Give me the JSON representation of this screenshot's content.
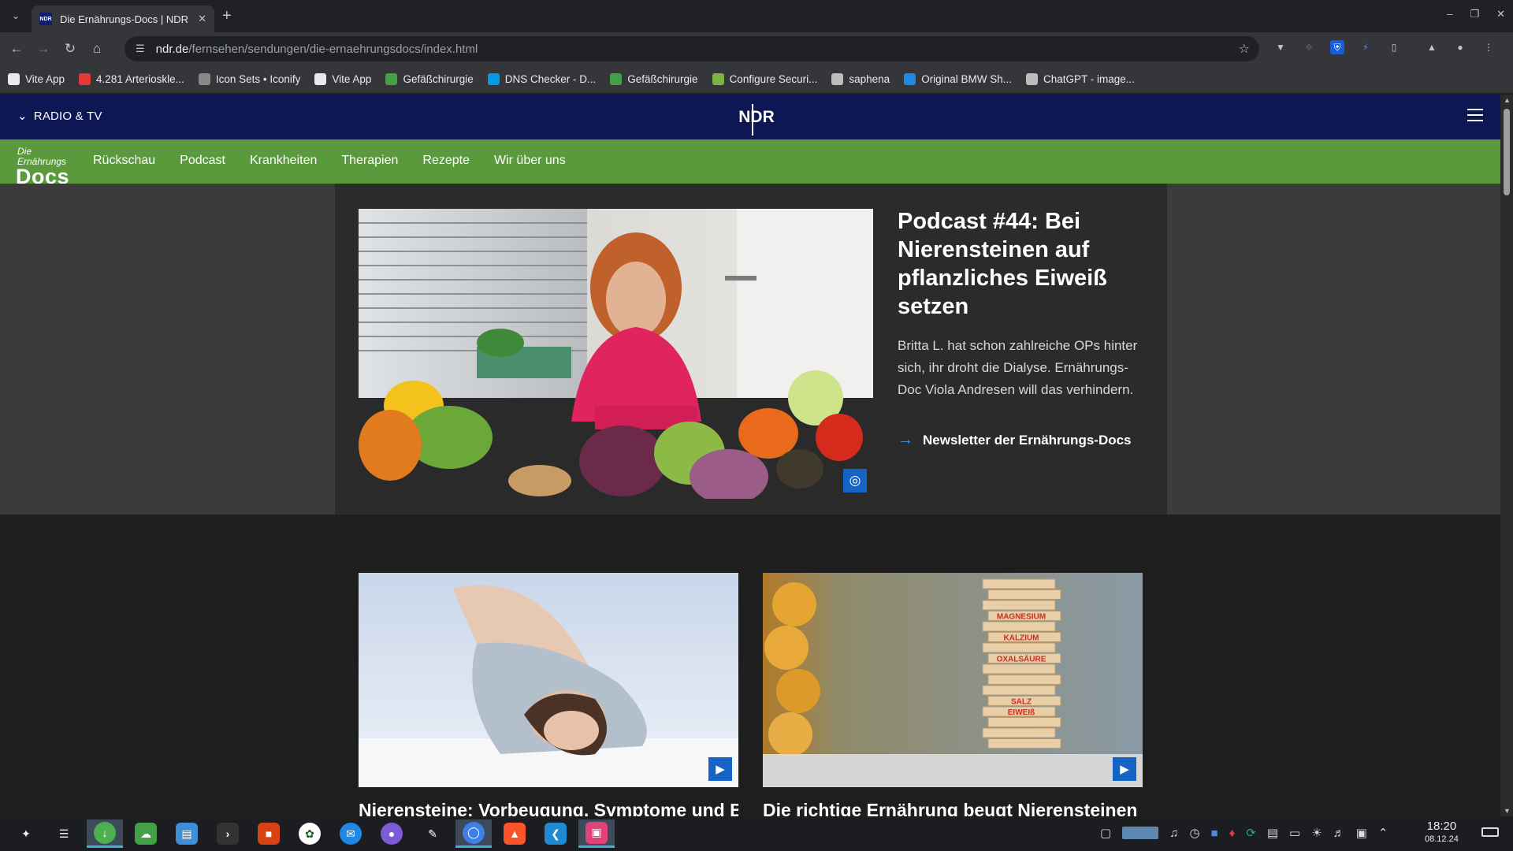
{
  "browser": {
    "tab_title": "Die Ernährungs-Docs | NDR",
    "tab_favicon": "NDR",
    "address_host": "ndr.de",
    "address_path": "/fernsehen/sendungen/die-ernaehrungsdocs/index.html",
    "bookmarks": [
      {
        "label": "Vite App",
        "color": "#e8eaed",
        "icon": "globe-icon"
      },
      {
        "label": "4.281 Arterioskle...",
        "color": "#e53935",
        "icon": "red-square-icon"
      },
      {
        "label": "Icon Sets • Iconify",
        "color": "#888888",
        "icon": "iconify-icon"
      },
      {
        "label": "Vite App",
        "color": "#e8eaed",
        "icon": "globe-icon"
      },
      {
        "label": "Gefäßchirurgie",
        "color": "#43a047",
        "icon": "leaf-icon"
      },
      {
        "label": "DNS Checker - D...",
        "color": "#039be5",
        "icon": "shield-icon"
      },
      {
        "label": "Gefäßchirurgie",
        "color": "#43a047",
        "icon": "leaf-icon"
      },
      {
        "label": "Configure Securi...",
        "color": "#7cb342",
        "icon": "v-icon"
      },
      {
        "label": "saphena",
        "color": "#bdbdbd",
        "icon": "folder-icon"
      },
      {
        "label": "Original BMW Sh...",
        "color": "#1e88e5",
        "icon": "bmw-icon"
      },
      {
        "label": "ChatGPT - image...",
        "color": "#bdbdbd",
        "icon": "chatgpt-icon"
      }
    ]
  },
  "ndr": {
    "radio_tv": "RADIO & TV",
    "logo": "NDR"
  },
  "docs_nav": {
    "logo_small": "Die Ernährungs",
    "logo_big": "Docs",
    "items": [
      "Rückschau",
      "Podcast",
      "Krankheiten",
      "Therapien",
      "Rezepte",
      "Wir über uns"
    ]
  },
  "hero": {
    "title": "Podcast #44: Bei Nierensteinen auf pflanzliches Eiweiß setzen",
    "description": "Britta L. hat schon zahlreiche OPs hinter sich, ihr droht die Dialyse. Ernährungs-Doc Viola Andresen will das verhindern.",
    "link": "Newsletter der Ernährungs-Docs"
  },
  "cards": [
    {
      "title": "Nierensteine: Vorbeugung, Symptome und Behandlung"
    },
    {
      "title": "Die richtige Ernährung beugt Nierensteinen vor"
    }
  ],
  "jenga_labels": [
    "MAGNESIUM",
    "KALZIUM",
    "OXALSÄURE",
    "SALZ",
    "EIWEIß"
  ],
  "taskbar": {
    "time": "18:20",
    "date": "08.12.24"
  }
}
